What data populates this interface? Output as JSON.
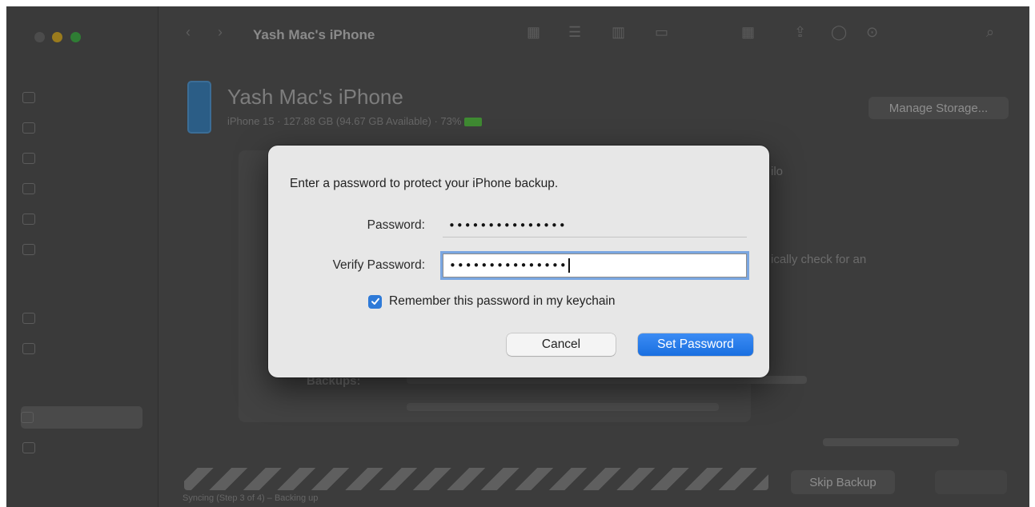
{
  "window": {
    "title": "Yash Mac's iPhone"
  },
  "device": {
    "name": "Yash Mac's iPhone",
    "subtitle": "iPhone 15 · 127.88 GB (94.67 GB Available) · 73%",
    "manage_storage_label": "Manage Storage..."
  },
  "background": {
    "partial_text_1": "ilo",
    "partial_text_2": "ically check for an",
    "backups_label": "Backups:"
  },
  "dialog": {
    "message": "Enter a password to protect your iPhone backup.",
    "password_label": "Password:",
    "password_value": "•••••••••••••••",
    "verify_label": "Verify Password:",
    "verify_value": "•••••••••••••••",
    "remember_label": "Remember this password in my keychain",
    "remember_checked": true,
    "cancel_label": "Cancel",
    "set_password_label": "Set Password"
  },
  "footer": {
    "skip_backup_label": "Skip Backup",
    "status": "Syncing (Step 3 of 4) – Backing up"
  },
  "colors": {
    "accent": "#1a6fe0",
    "checkbox": "#2e7ad8",
    "focus_ring": "#7aa6e0"
  }
}
